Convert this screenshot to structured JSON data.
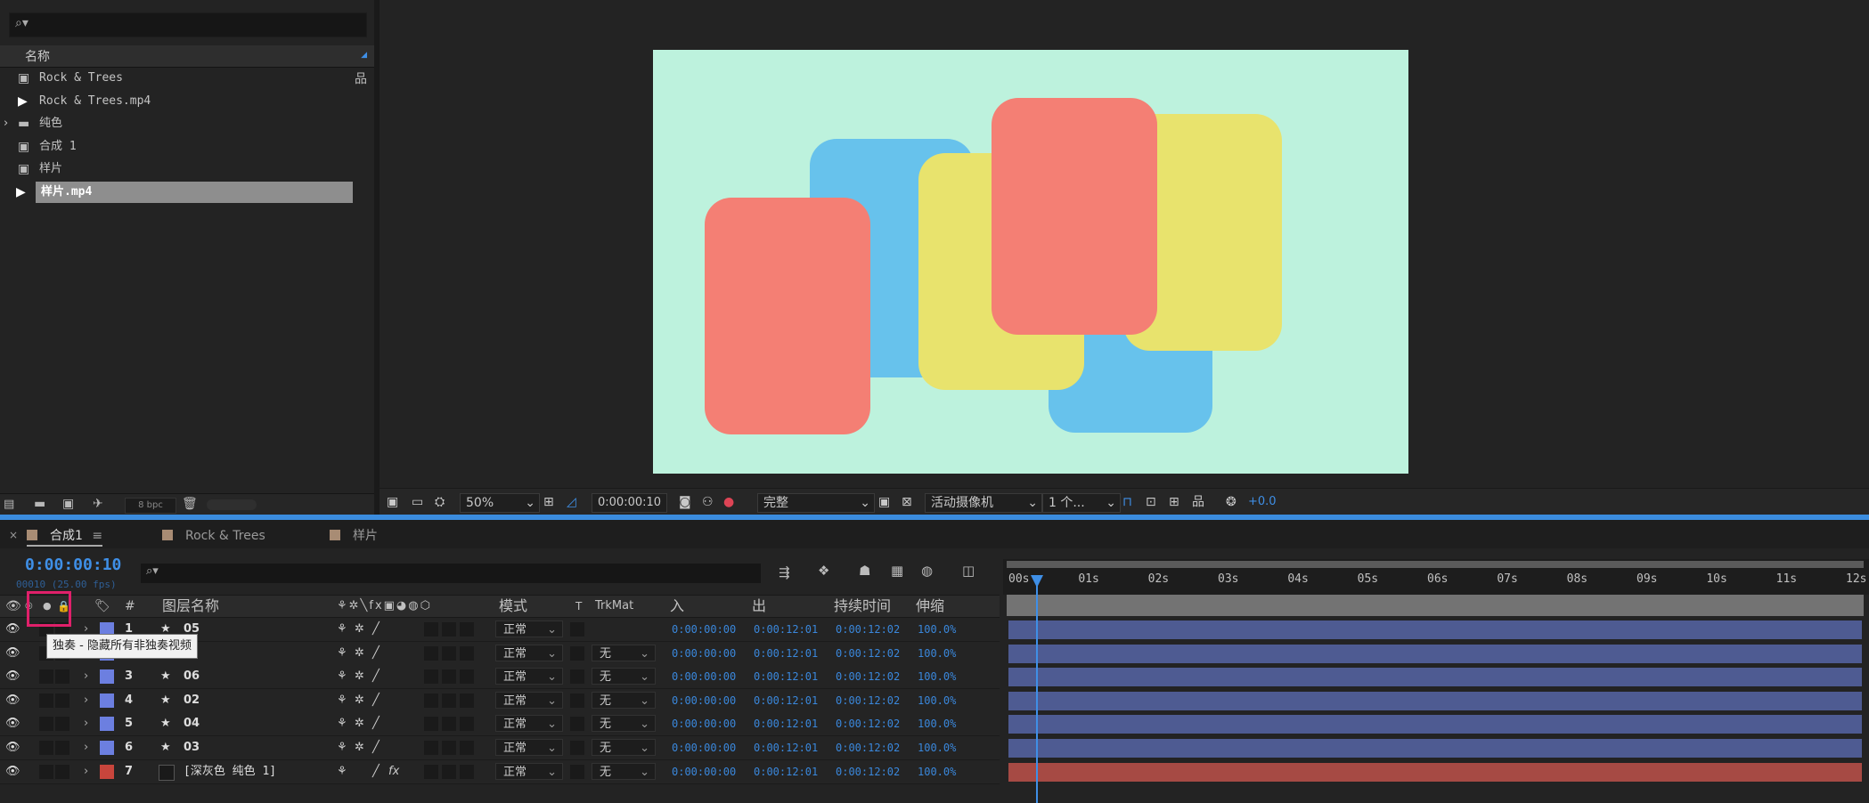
{
  "project": {
    "search_placeholder": "",
    "column_name": "名称",
    "items": [
      {
        "name": "Rock & Trees",
        "type": "composition-icon"
      },
      {
        "name": "Rock & Trees.mp4",
        "type": "footage-icon"
      },
      {
        "name": "纯色",
        "type": "folder-icon"
      },
      {
        "name": "合成 1",
        "type": "composition-icon"
      },
      {
        "name": "样片",
        "type": "composition-icon"
      },
      {
        "name": "样片.mp4",
        "type": "footage-icon",
        "selected": true
      }
    ],
    "bpc": "8 bpc"
  },
  "viewer": {
    "zoom": "50%",
    "timecode": "0:00:00:10",
    "resolution": "完整",
    "camera": "活动摄像机",
    "views": "1 个...",
    "exposure": "+0.0",
    "background_color": "#bdf2dd",
    "card_colors": {
      "red": "#f47f74",
      "blue": "#67c2ec",
      "yellow": "#e8e36d"
    }
  },
  "timeline": {
    "tabs": [
      {
        "label": "合成1",
        "active": true
      },
      {
        "label": "Rock & Trees"
      },
      {
        "label": "样片"
      }
    ],
    "current_time": "0:00:00:10",
    "fps": "00010 (25.00 fps)",
    "columns": {
      "number": "#",
      "layer_name": "图层名称",
      "mode": "模式",
      "t": "T",
      "trkmat": "TrkMat",
      "in": "入",
      "out": "出",
      "duration": "持续时间",
      "stretch": "伸缩"
    },
    "ruler_ticks": [
      "00s",
      "01s",
      "02s",
      "03s",
      "04s",
      "05s",
      "06s",
      "07s",
      "08s",
      "09s",
      "10s",
      "11s",
      "12s"
    ],
    "tooltip": "独奏 - 隐藏所有非独奏视频",
    "layers": [
      {
        "num": "1",
        "name": "05",
        "mode": "正常",
        "trkmat": "",
        "in": "0:00:00:00",
        "out": "0:00:12:01",
        "duration": "0:00:12:02",
        "stretch": "100.0%",
        "color": "#6c7fe0"
      },
      {
        "num": "2",
        "name": "",
        "mode": "正常",
        "trkmat": "无",
        "in": "0:00:00:00",
        "out": "0:00:12:01",
        "duration": "0:00:12:02",
        "stretch": "100.0%",
        "color": "#6c7fe0"
      },
      {
        "num": "3",
        "name": "06",
        "mode": "正常",
        "trkmat": "无",
        "in": "0:00:00:00",
        "out": "0:00:12:01",
        "duration": "0:00:12:02",
        "stretch": "100.0%",
        "color": "#6c7fe0"
      },
      {
        "num": "4",
        "name": "02",
        "mode": "正常",
        "trkmat": "无",
        "in": "0:00:00:00",
        "out": "0:00:12:01",
        "duration": "0:00:12:02",
        "stretch": "100.0%",
        "color": "#6c7fe0"
      },
      {
        "num": "5",
        "name": "04",
        "mode": "正常",
        "trkmat": "无",
        "in": "0:00:00:00",
        "out": "0:00:12:01",
        "duration": "0:00:12:02",
        "stretch": "100.0%",
        "color": "#6c7fe0"
      },
      {
        "num": "6",
        "name": "03",
        "mode": "正常",
        "trkmat": "无",
        "in": "0:00:00:00",
        "out": "0:00:12:01",
        "duration": "0:00:12:02",
        "stretch": "100.0%",
        "color": "#6c7fe0"
      },
      {
        "num": "7",
        "name": "[深灰色 纯色 1]",
        "mode": "正常",
        "trkmat": "无",
        "in": "0:00:00:00",
        "out": "0:00:12:01",
        "duration": "0:00:12:02",
        "stretch": "100.0%",
        "color": "#c8453c"
      }
    ],
    "bar_colors": {
      "default": "#4e5b92",
      "solid": "#a64a44"
    }
  }
}
